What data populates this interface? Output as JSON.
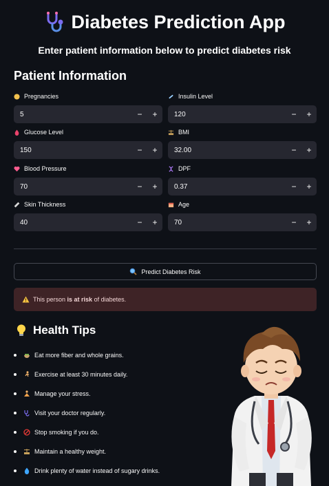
{
  "header": {
    "title": "Diabetes Prediction App",
    "logo_icon": "stethoscope-icon",
    "subtitle": "Enter patient information below to predict diabetes risk"
  },
  "form": {
    "section_title": "Patient Information",
    "fields": [
      {
        "label": "Pregnancies",
        "value": "5",
        "icon": "baby-icon",
        "color": "#f2c14e"
      },
      {
        "label": "Insulin Level",
        "value": "120",
        "icon": "syringe-icon",
        "color": "#9ad0ff"
      },
      {
        "label": "Glucose Level",
        "value": "150",
        "icon": "drop-icon",
        "color": "#e8436b"
      },
      {
        "label": "BMI",
        "value": "32.00",
        "icon": "scale-icon",
        "color": "#c8a15a"
      },
      {
        "label": "Blood Pressure",
        "value": "70",
        "icon": "heart-icon",
        "color": "#ff5d8f"
      },
      {
        "label": "DPF",
        "value": "0.37",
        "icon": "dna-icon",
        "color": "#b27cff"
      },
      {
        "label": "Skin Thickness",
        "value": "40",
        "icon": "ruler-icon",
        "color": "#d8d8d8"
      },
      {
        "label": "Age",
        "value": "70",
        "icon": "calendar-icon",
        "color": "#f4b183"
      }
    ],
    "minus": "−",
    "plus": "+"
  },
  "predict_button": {
    "label": "Predict Diabetes Risk",
    "icon": "magnifier-icon"
  },
  "result": {
    "prefix": "This person ",
    "emphasis": "is at risk",
    "suffix": " of diabetes.",
    "icon": "warning-icon",
    "bg_color": "#3e2326"
  },
  "tips": {
    "title": "Health Tips",
    "icon": "lightbulb-icon",
    "items": [
      {
        "text": "Eat more fiber and whole grains.",
        "icon": "bowl-icon"
      },
      {
        "text": "Exercise at least 30 minutes daily.",
        "icon": "running-icon"
      },
      {
        "text": "Manage your stress.",
        "icon": "meditation-icon"
      },
      {
        "text": "Visit your doctor regularly.",
        "icon": "stethoscope-icon"
      },
      {
        "text": "Stop smoking if you do.",
        "icon": "no-smoking-icon"
      },
      {
        "text": "Maintain a healthy weight.",
        "icon": "scale-icon"
      },
      {
        "text": "Drink plenty of water instead of sugary drinks.",
        "icon": "water-drop-icon"
      }
    ]
  },
  "colors": {
    "background": "#0e1117",
    "input_bg": "#262730",
    "text": "#fafafa"
  }
}
